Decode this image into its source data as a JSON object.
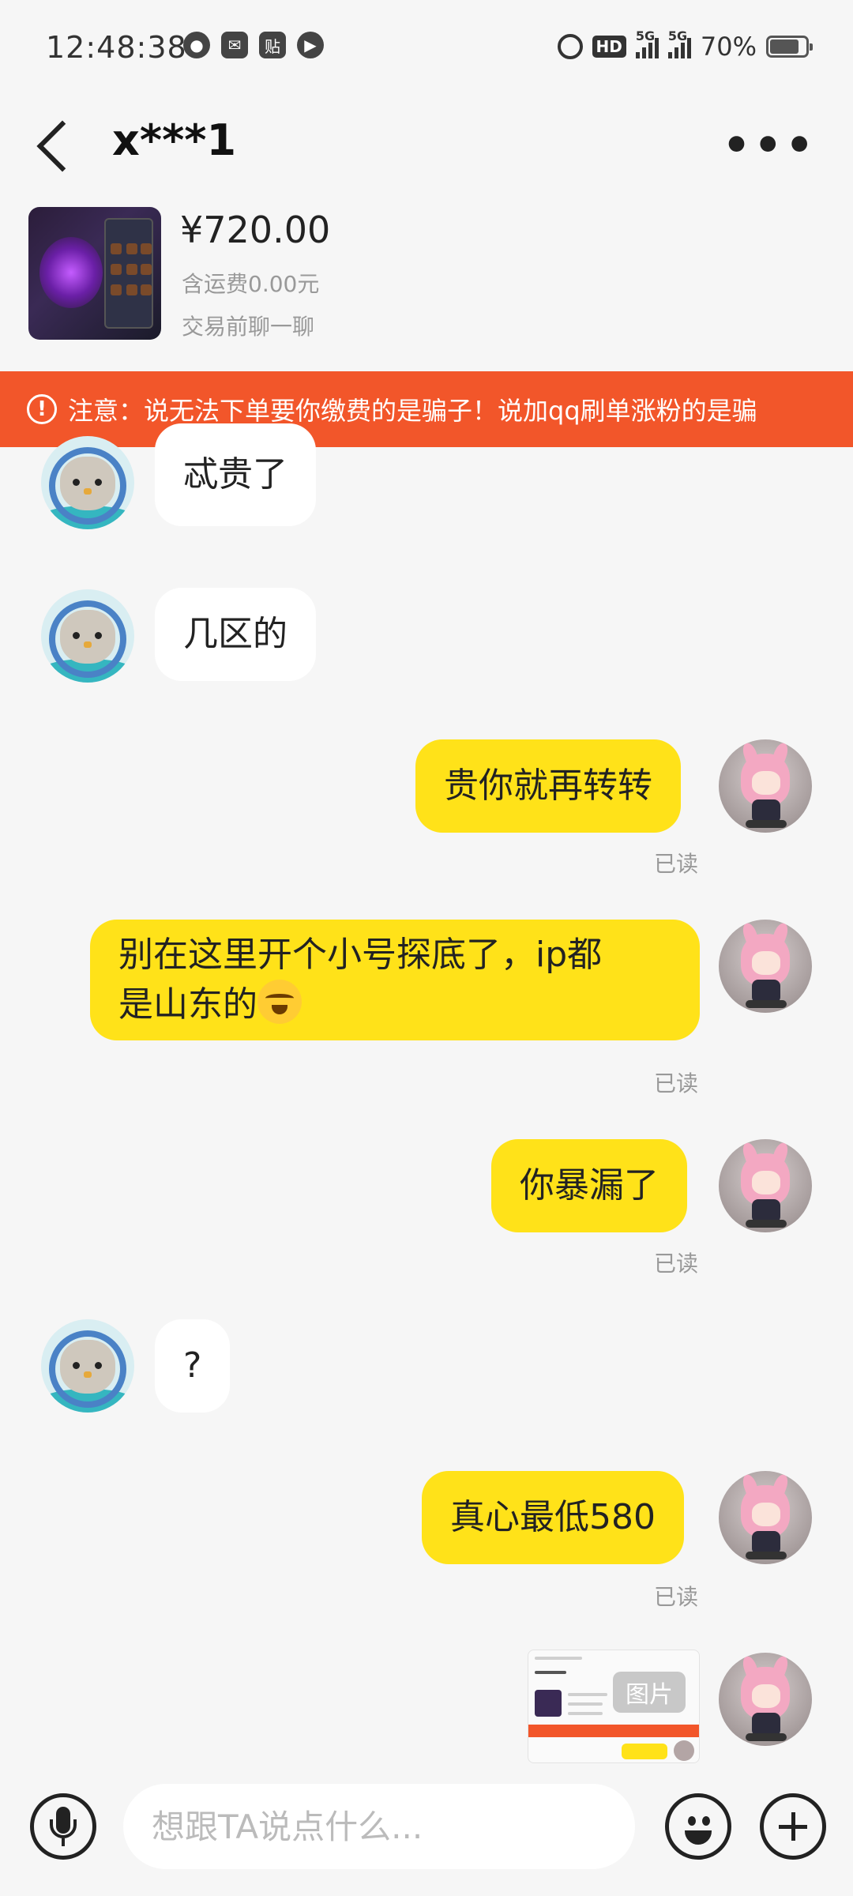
{
  "status_bar": {
    "time": "12:48:38",
    "network": "5G",
    "battery": "70%"
  },
  "header": {
    "title": "x***1"
  },
  "product": {
    "price": "¥720.00",
    "shipping": "含运费0.00元",
    "hint": "交易前聊一聊"
  },
  "warning": {
    "text": "注意：说无法下单要你缴费的是骗子！说加qq刷单涨粉的是骗"
  },
  "messages": [
    {
      "side": "in",
      "text": "忒贵了"
    },
    {
      "side": "in",
      "text": "几区的"
    },
    {
      "side": "out",
      "text": "贵你就再转转",
      "status": "已读"
    },
    {
      "side": "out",
      "text_line1": "别在这里开个小号探底了，ip都",
      "text_line2": "是山东的",
      "emoji": "crying-laughing",
      "status": "已读"
    },
    {
      "side": "out",
      "text": "你暴漏了",
      "status": "已读"
    },
    {
      "side": "in",
      "text": "?"
    },
    {
      "side": "out",
      "text": "真心最低580",
      "status": "已读"
    },
    {
      "side": "out",
      "type": "image",
      "tag": "图片"
    }
  ],
  "input": {
    "placeholder": "想跟TA说点什么..."
  },
  "colors": {
    "warning_bg": "#f2562a",
    "out_bubble": "#ffe219",
    "in_bubble": "#ffffff",
    "page_bg": "#f6f6f6"
  }
}
